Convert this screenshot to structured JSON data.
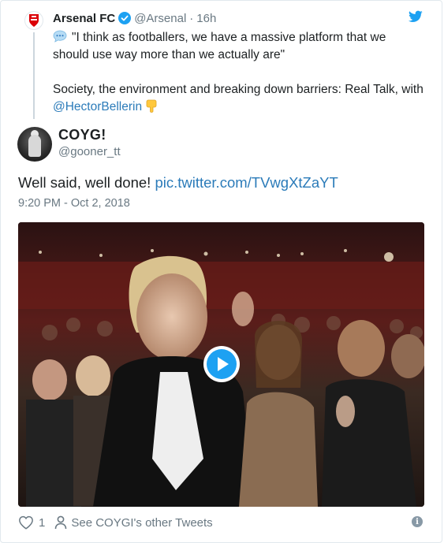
{
  "parent_tweet": {
    "name": "Arsenal FC",
    "handle": "@Arsenal",
    "separator": "·",
    "time": "16h",
    "quote": "\"I think as footballers, we have a massive platform that we should use way more than we actually are\"",
    "body_prefix": "Society, the environment and breaking down barriers: Real Talk, with",
    "mention": "@HectorBellerin",
    "emoji_speech": "speech-balloon-icon",
    "emoji_hand": "backhand-index-pointing-down-icon"
  },
  "tweet": {
    "name": "COYG!",
    "handle": "@gooner_tt",
    "text": "Well said, well done!",
    "link": "pic.twitter.com/TVwgXtZaYT",
    "timestamp": "9:20 PM - Oct 2, 2018"
  },
  "media": {
    "type": "video",
    "play_icon": "play-icon"
  },
  "footer": {
    "like_count": "1",
    "other_tweets": "See COYGI's other Tweets",
    "info_icon": "info-icon"
  },
  "colors": {
    "link": "#2b7bb9",
    "twitter_blue": "#1da1f2",
    "muted": "#697882",
    "text": "#1c2022",
    "border": "#e1e8ed"
  }
}
